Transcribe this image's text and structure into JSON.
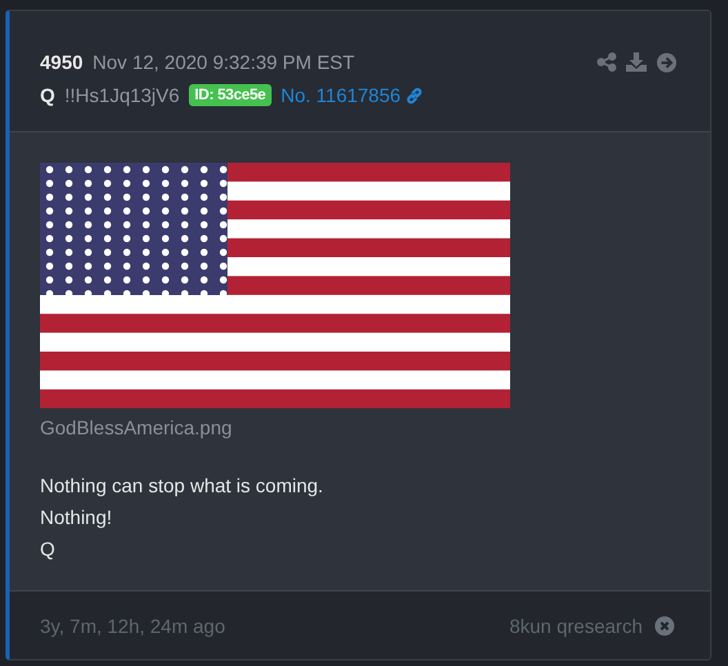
{
  "post": {
    "number": "4950",
    "timestamp": "Nov 12, 2020 9:32:39 PM EST",
    "author": "Q",
    "tripcode": "!!Hs1Jq13jV6",
    "id_badge": "ID: 53ce5e",
    "post_link": "No. 11617856",
    "image": {
      "kind": "picture",
      "filename": "GodBlessAmerica.png"
    },
    "message": [
      "Nothing can stop what is coming.",
      "Nothing!",
      "Q"
    ]
  },
  "footer": {
    "age": "3y, 7m, 12h, 24m ago",
    "board": "8kun qresearch"
  }
}
